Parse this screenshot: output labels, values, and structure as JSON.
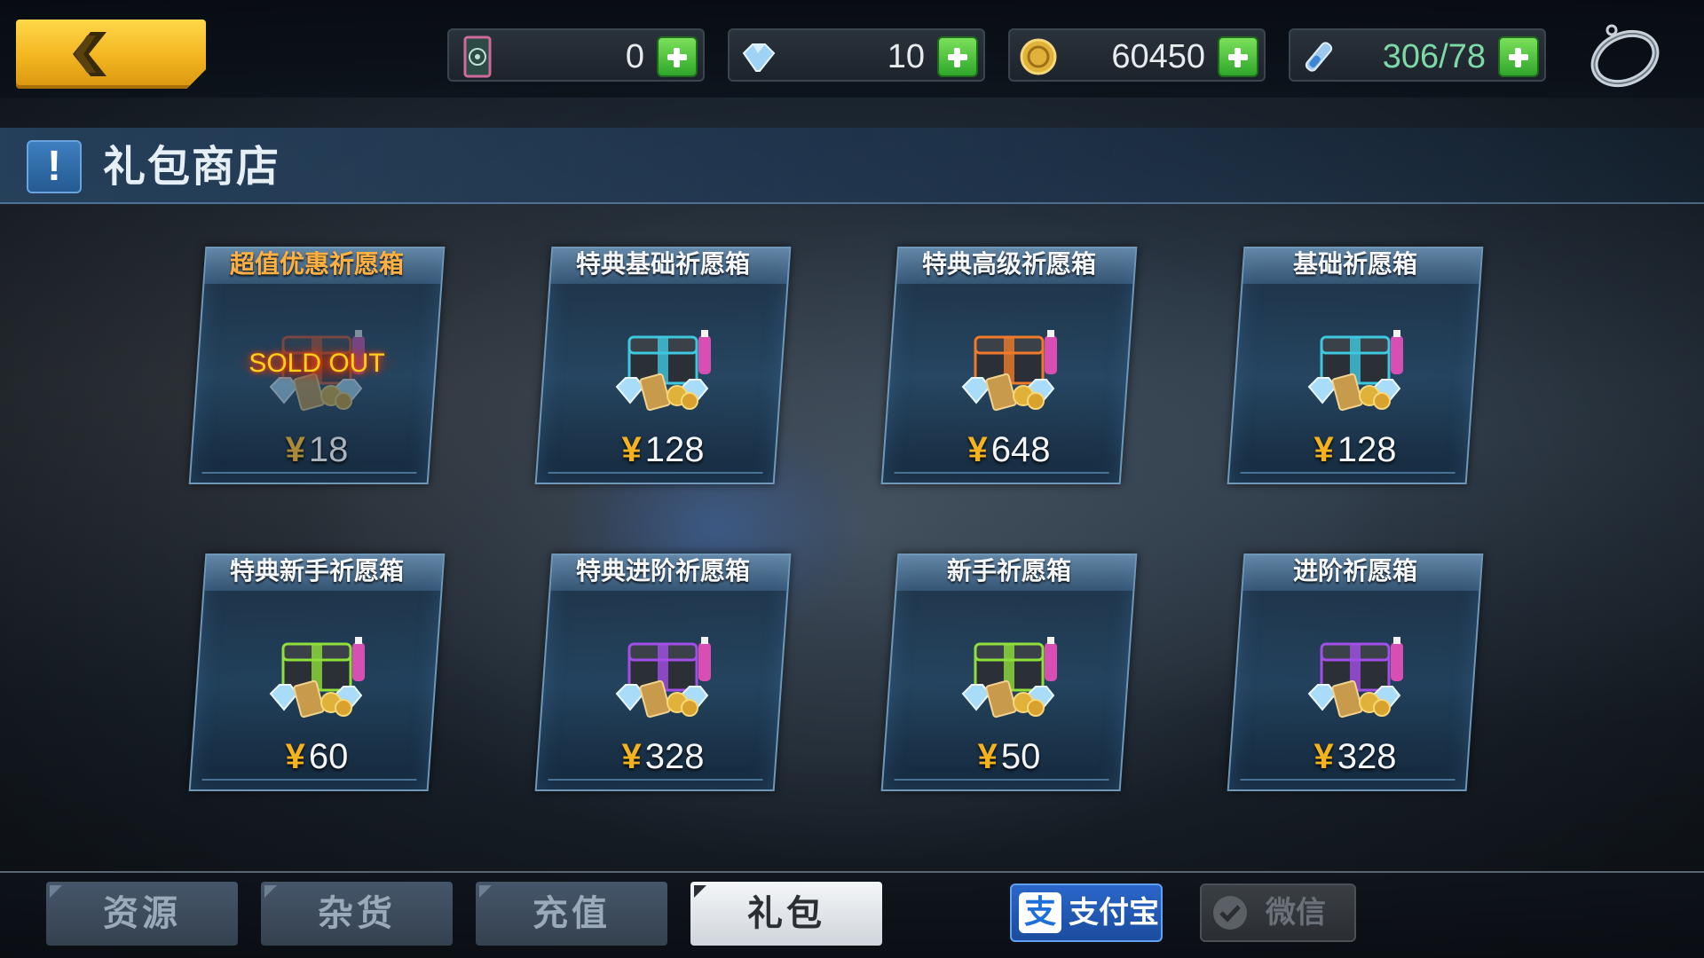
{
  "header": {
    "back_icon": "chevron-left-icon",
    "currencies": [
      {
        "name": "card-ticket",
        "icon": "ticket-card-icon",
        "value": "0"
      },
      {
        "name": "diamond",
        "icon": "diamond-icon",
        "value": "10"
      },
      {
        "name": "gold-coin",
        "icon": "gold-coin-icon",
        "value": "60450"
      },
      {
        "name": "stamina",
        "icon": "energy-vial-icon",
        "value": "306/78"
      }
    ],
    "settings_icon": "ring-settings-icon"
  },
  "title_bar": {
    "mark": "!",
    "title": "礼包商店"
  },
  "products": [
    {
      "name": "超值优惠祈愿箱",
      "price": "18",
      "currency_symbol": "¥",
      "status": "SOLD OUT",
      "sold_out": true,
      "box_color": "#e0542a"
    },
    {
      "name": "特典基础祈愿箱",
      "price": "128",
      "currency_symbol": "¥",
      "box_color": "#3ec8e0"
    },
    {
      "name": "特典高级祈愿箱",
      "price": "648",
      "currency_symbol": "¥",
      "box_color": "#f07a2a"
    },
    {
      "name": "基础祈愿箱",
      "price": "128",
      "currency_symbol": "¥",
      "box_color": "#3ec8e0"
    },
    {
      "name": "特典新手祈愿箱",
      "price": "60",
      "currency_symbol": "¥",
      "box_color": "#8fe03a"
    },
    {
      "name": "特典进阶祈愿箱",
      "price": "328",
      "currency_symbol": "¥",
      "box_color": "#a24fe8"
    },
    {
      "name": "新手祈愿箱",
      "price": "50",
      "currency_symbol": "¥",
      "box_color": "#8fe03a"
    },
    {
      "name": "进阶祈愿箱",
      "price": "328",
      "currency_symbol": "¥",
      "box_color": "#a24fe8"
    }
  ],
  "tabs": [
    {
      "label": "资源",
      "active": false
    },
    {
      "label": "杂货",
      "active": false
    },
    {
      "label": "充值",
      "active": false
    },
    {
      "label": "礼包",
      "active": true
    }
  ],
  "payment": {
    "alipay": {
      "logo_char": "支",
      "label": "支付宝",
      "enabled": true
    },
    "wechat": {
      "label": "微信",
      "enabled": false
    }
  },
  "colors": {
    "accent_yellow": "#f5b21f",
    "plus_green": "#2fa72b",
    "alipay_blue": "#1b4c9e",
    "active_tab": "#e6eaee"
  }
}
